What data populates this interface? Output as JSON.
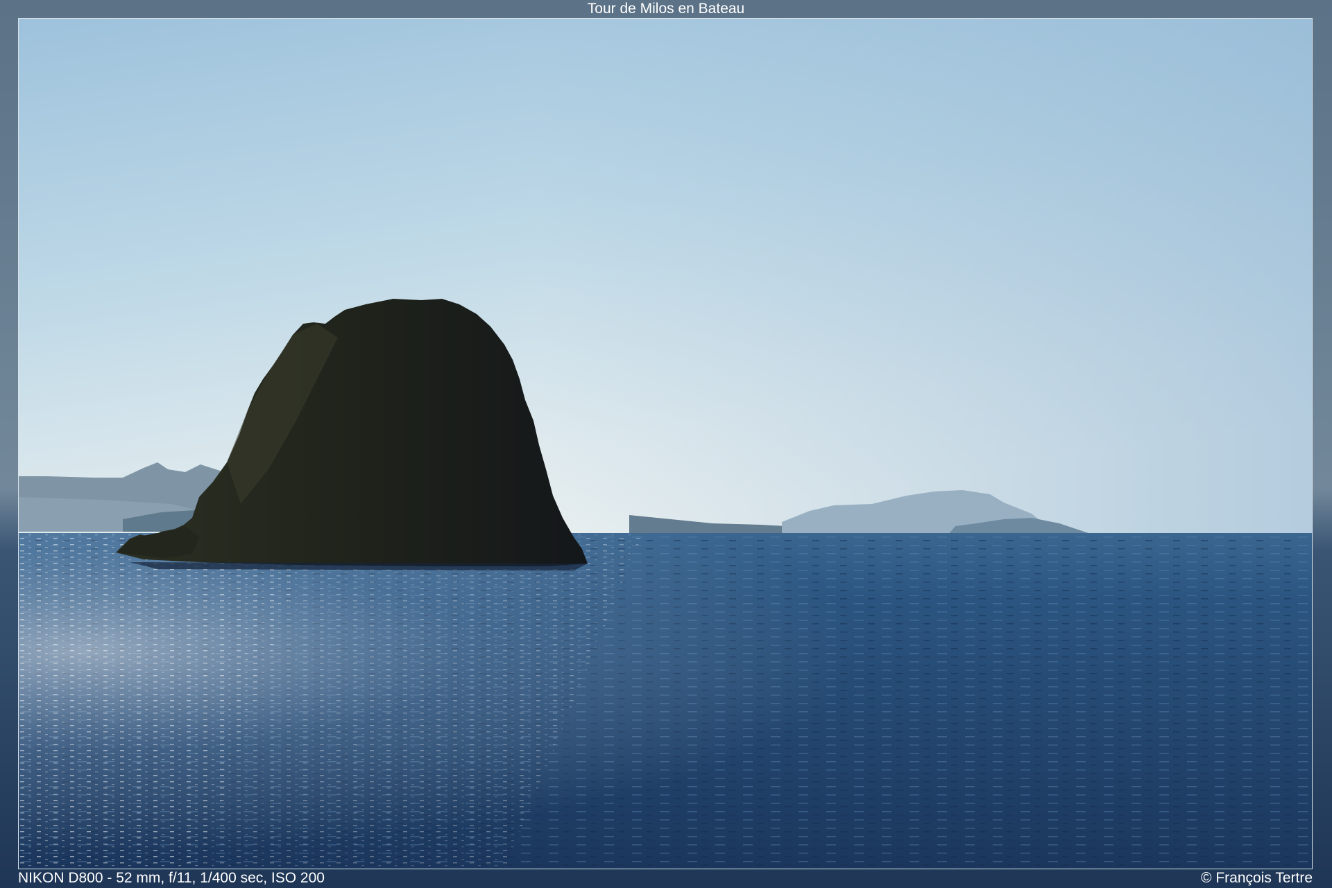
{
  "photo": {
    "title": "Tour de Milos en Bateau",
    "exif": "NIKON D800 - 52 mm, f/11, 1/400 sec, ISO 200",
    "copyright": "© François Tertre"
  },
  "colors": {
    "sky_top": "#8eb4d0",
    "sky_horizon": "#e4ecef",
    "sea_near": "#1e3a5f",
    "sea_far": "#2d5680",
    "rock": "#1c1f18",
    "distant_islands": "#7f99ad"
  }
}
